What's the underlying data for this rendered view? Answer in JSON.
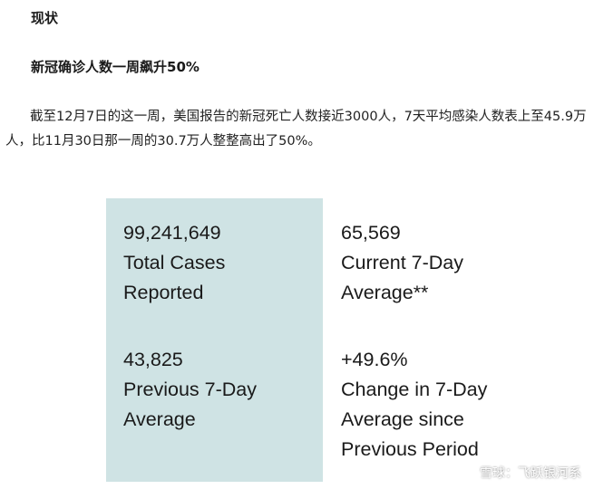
{
  "article": {
    "section_title": "现状",
    "subtitle": "新冠确诊人数一周飙升50%",
    "paragraph": "截至12月7日的这一周，美国报告的新冠死亡人数接近3000人，7天平均感染人数表上至45.9万人，比11月30日那一周的30.7万人整整高出了50%。"
  },
  "stats": [
    {
      "value": "99,241,649",
      "label": "Total Cases\nReported"
    },
    {
      "value": "65,569",
      "label": "Current 7-Day\nAverage**"
    },
    {
      "value": "43,825",
      "label": "Previous 7-Day\nAverage"
    },
    {
      "value": "+49.6%",
      "label": "Change in 7-Day\nAverage since\nPrevious Period"
    }
  ],
  "watermark": {
    "text": "雪球：飞跃银河系",
    "icon": "snowball-logo"
  },
  "colors": {
    "card_background": "#cfe3e4",
    "text": "#1a1a1a"
  }
}
